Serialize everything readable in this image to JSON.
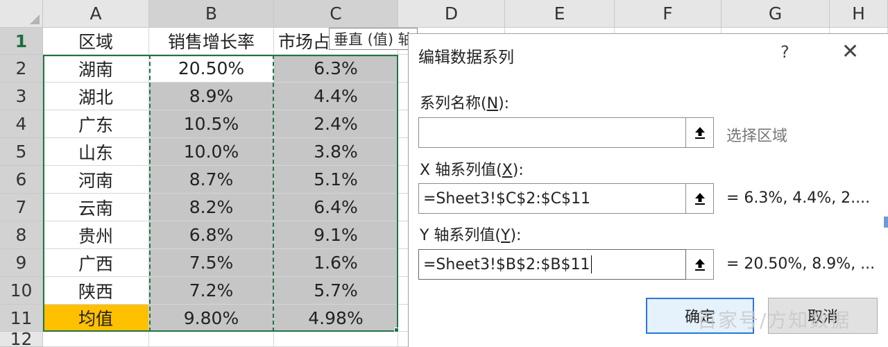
{
  "sheet": {
    "columns": [
      "A",
      "B",
      "C",
      "D",
      "E",
      "F",
      "G",
      "H"
    ],
    "rows": [
      "1",
      "2",
      "3",
      "4",
      "5",
      "6",
      "7",
      "8",
      "9",
      "10",
      "11",
      "12"
    ],
    "header_row": [
      "区域",
      "销售增长率",
      "市场占"
    ],
    "data": [
      [
        "湖南",
        "20.50%",
        "6.3%"
      ],
      [
        "湖北",
        "8.9%",
        "4.4%"
      ],
      [
        "广东",
        "10.5%",
        "2.4%"
      ],
      [
        "山东",
        "10.0%",
        "3.8%"
      ],
      [
        "河南",
        "8.7%",
        "5.1%"
      ],
      [
        "云南",
        "8.2%",
        "6.4%"
      ],
      [
        "贵州",
        "6.8%",
        "9.1%"
      ],
      [
        "广西",
        "7.5%",
        "1.6%"
      ],
      [
        "陕西",
        "7.2%",
        "5.7%"
      ],
      [
        "均值",
        "9.80%",
        "4.98%"
      ]
    ],
    "highlight_color": "#ffc000",
    "selected_fill": "#c6c6c6",
    "selection_border": "#217346"
  },
  "tooltip": "垂直 (值) 轴",
  "dialog": {
    "title": "编辑数据系列",
    "help": "?",
    "close": "✕",
    "series_name_label_pre": "系列名称(",
    "series_name_label_key": "N",
    "series_name_label_post": "):",
    "series_name_value": "",
    "series_name_hint": "选择区域",
    "x_label_pre": "X 轴系列值(",
    "x_label_key": "X",
    "x_label_post": "):",
    "x_value": "=Sheet3!$C$2:$C$11",
    "x_preview": "= 6.3%, 4.4%, 2....",
    "y_label_pre": "Y 轴系列值(",
    "y_label_key": "Y",
    "y_label_post": "):",
    "y_value": "=Sheet3!$B$2:$B$11",
    "y_preview": "= 20.50%, 8.9%, ...",
    "ok": "确定",
    "cancel": "取消"
  },
  "watermark": "百家号/方知数据"
}
